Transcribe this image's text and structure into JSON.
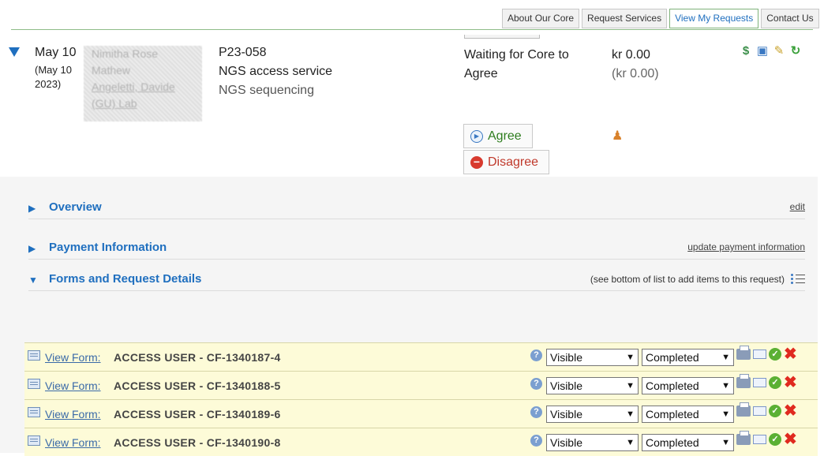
{
  "nav": {
    "tabs": [
      {
        "label": "About Our Core"
      },
      {
        "label": "Request Services"
      },
      {
        "label": "View My Requests"
      },
      {
        "label": "Contact Us"
      }
    ],
    "active_tab": "View My Requests"
  },
  "request": {
    "date": "May 10",
    "date_detail": "(May 10 2023)",
    "requester_line1": "Nimitha Rose",
    "requester_line2": "Mathew",
    "requester_lab_line1": "Angeletti, Davide",
    "requester_lab_line2": "(GU) Lab",
    "project_id": "P23-058",
    "service": "NGS access service",
    "service_sub": "NGS sequencing",
    "status": "Waiting for Core to Agree",
    "amount": "kr 0.00",
    "amount_sub": "(kr 0.00)",
    "agree_label": "Agree",
    "disagree_label": "Disagree"
  },
  "sections": {
    "overview": {
      "title": "Overview",
      "action": "edit"
    },
    "payment": {
      "title": "Payment Information",
      "action": "update payment information"
    },
    "forms": {
      "title": "Forms and Request Details",
      "note": "(see bottom of list to add items to this request)"
    }
  },
  "form_rows": [
    {
      "link": "View Form:",
      "name": "ACCESS USER - CF-1340187-4",
      "visibility": "Visible",
      "status": "Completed"
    },
    {
      "link": "View Form:",
      "name": "ACCESS USER - CF-1340188-5",
      "visibility": "Visible",
      "status": "Completed"
    },
    {
      "link": "View Form:",
      "name": "ACCESS USER - CF-1340189-6",
      "visibility": "Visible",
      "status": "Completed"
    },
    {
      "link": "View Form:",
      "name": "ACCESS USER - CF-1340190-8",
      "visibility": "Visible",
      "status": "Completed"
    }
  ],
  "colors": {
    "accent": "#1f6fbf",
    "nav_line": "#8fbd88",
    "form_row_bg": "#fdfbd8"
  }
}
